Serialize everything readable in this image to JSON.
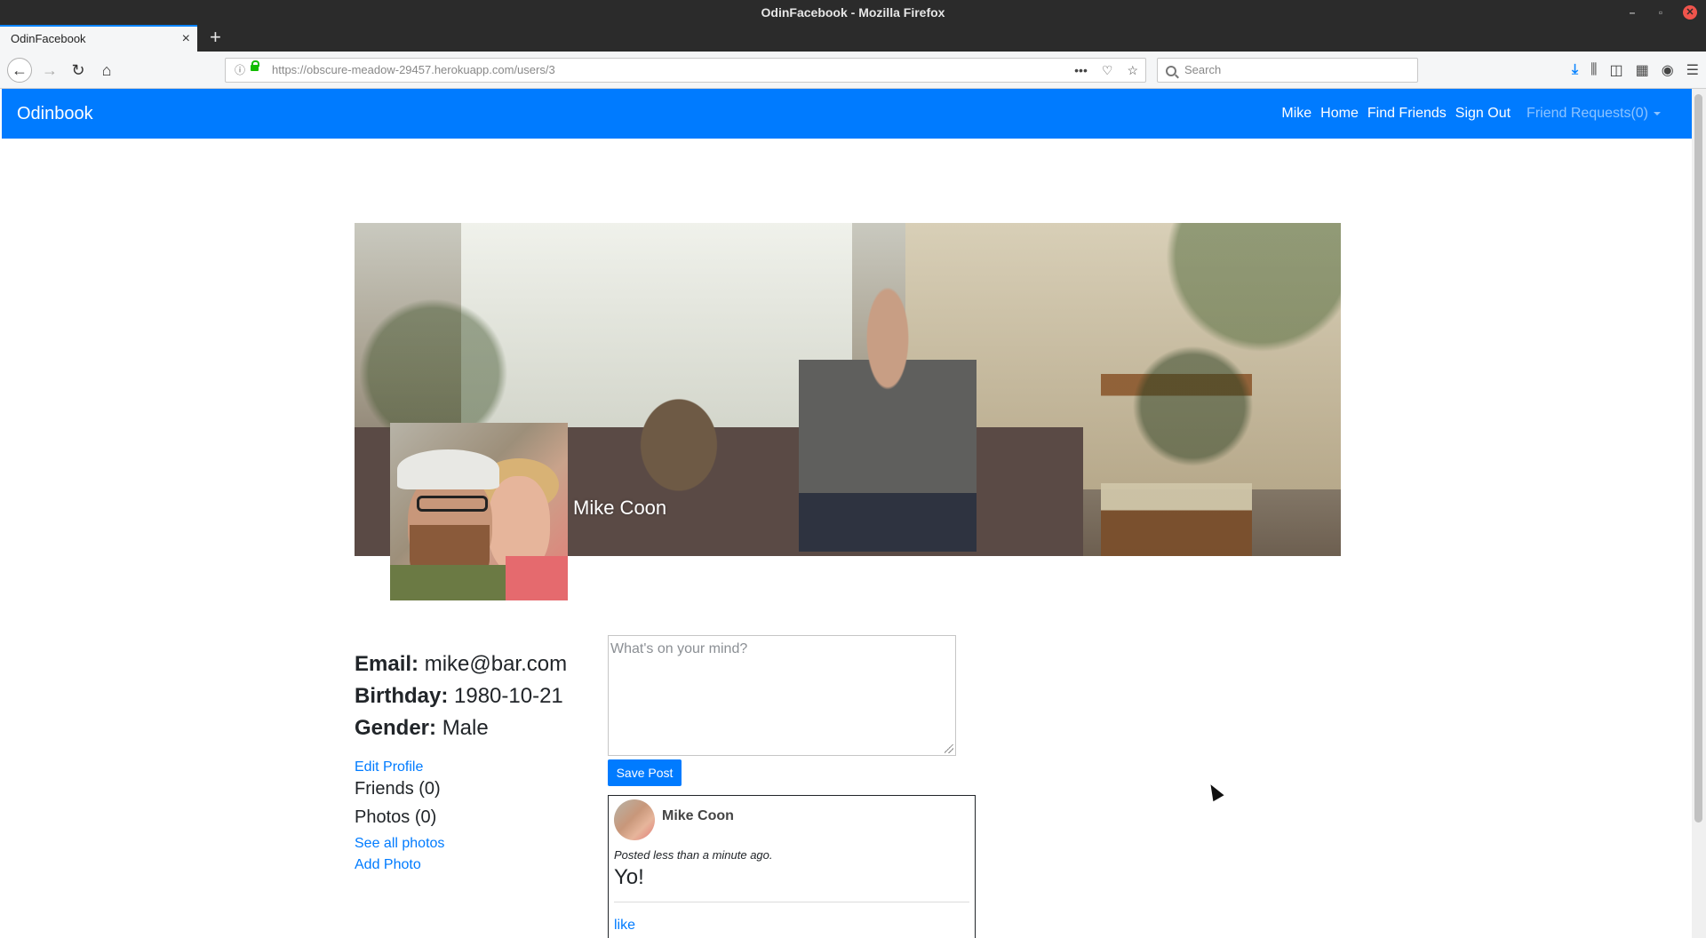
{
  "window": {
    "title": "OdinFacebook - Mozilla Firefox"
  },
  "browser": {
    "tab_title": "OdinFacebook",
    "url_host": "https://obscure-meadow-29457.herokuapp.com",
    "url_path": "/users/3",
    "search_placeholder": "Search"
  },
  "appbar": {
    "brand": "Odinbook",
    "links": [
      "Mike",
      "Home",
      "Find Friends",
      "Sign Out"
    ],
    "friend_requests": "Friend Requests(0)"
  },
  "profile": {
    "name": "Mike Coon",
    "email_label": "Email:",
    "email": "mike@bar.com",
    "birthday_label": "Birthday:",
    "birthday": "1980-10-21",
    "gender_label": "Gender:",
    "gender": "Male",
    "edit_profile": "Edit Profile",
    "friends": "Friends (0)",
    "photos": "Photos (0)",
    "see_all_photos": "See all photos",
    "add_photo": "Add Photo"
  },
  "composer": {
    "placeholder": "What's on your mind?",
    "save_label": "Save Post"
  },
  "post": {
    "author": "Mike Coon",
    "time": "Posted less than a minute ago.",
    "body": "Yo!",
    "like": "like"
  },
  "colors": {
    "primary": "#007bff",
    "chrome_dark": "#2b2b2b"
  }
}
